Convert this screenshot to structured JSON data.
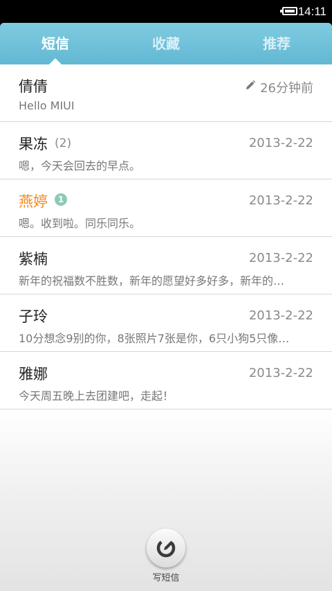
{
  "status_bar": {
    "time": "14:11",
    "battery_icon": "battery-icon"
  },
  "tabs": [
    {
      "label": "短信",
      "active": true
    },
    {
      "label": "收藏",
      "active": false
    },
    {
      "label": "推荐",
      "active": false
    }
  ],
  "conversations": [
    {
      "name": "倩倩",
      "count": "",
      "unread": "",
      "time": "26分钟前",
      "draft_icon": "pencil-icon",
      "preview": "Hello MIUI"
    },
    {
      "name": "果冻",
      "count": "(2)",
      "unread": "",
      "time": "2013-2-22",
      "preview": "嗯，今天会回去的早点。"
    },
    {
      "name": "燕婷",
      "count": "",
      "unread": "1",
      "time": "2013-2-22",
      "preview": "嗯。收到啦。同乐同乐。",
      "highlight_color": "#f08a1a"
    },
    {
      "name": "紫楠",
      "count": "",
      "unread": "",
      "time": "2013-2-22",
      "preview": "新年的祝福数不胜数，新年的愿望好多好多，新年的…"
    },
    {
      "name": "子玲",
      "count": "",
      "unread": "",
      "time": "2013-2-22",
      "preview": "10分想念9别的你，8张照片7张是你，6只小狗5只像…"
    },
    {
      "name": "雅娜",
      "count": "",
      "unread": "",
      "time": "2013-2-22",
      "preview": "今天周五晚上去团建吧，走起！"
    }
  ],
  "compose": {
    "label": "写短信",
    "icon": "compose-icon"
  },
  "colors": {
    "tab_bar": "#6cc0d8",
    "highlight": "#f08a1a",
    "badge": "#8fc9b6"
  }
}
